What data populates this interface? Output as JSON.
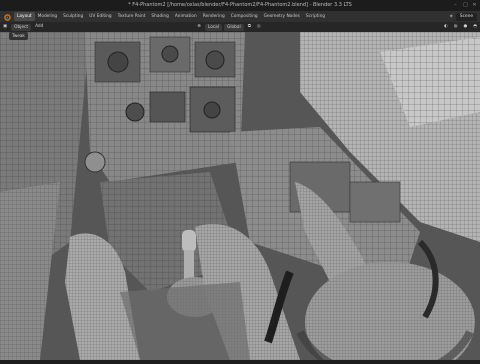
{
  "window": {
    "title": "* F4-Phantom2 [/home/oxlas/blender/F4-Phantom2/F4-Phantom2.blend] - Blender 3.3 LTS"
  },
  "menubar": {
    "workspaces": [
      "Layout",
      "Modeling",
      "Sculpting",
      "UV Editing",
      "Texture Paint",
      "Shading",
      "Animation",
      "Rendering",
      "Compositing",
      "Geometry Nodes",
      "Scripting"
    ],
    "scene_label": "Scene"
  },
  "header": {
    "items": [
      "Object",
      "Add",
      "Local",
      "Global"
    ],
    "view_label": "Tweak"
  },
  "colors": {
    "viewport_bg": "#3a3a3a",
    "mesh_fill": "#8e8e8e",
    "wire": "#2a2a2a",
    "accent": "#4772b3"
  }
}
